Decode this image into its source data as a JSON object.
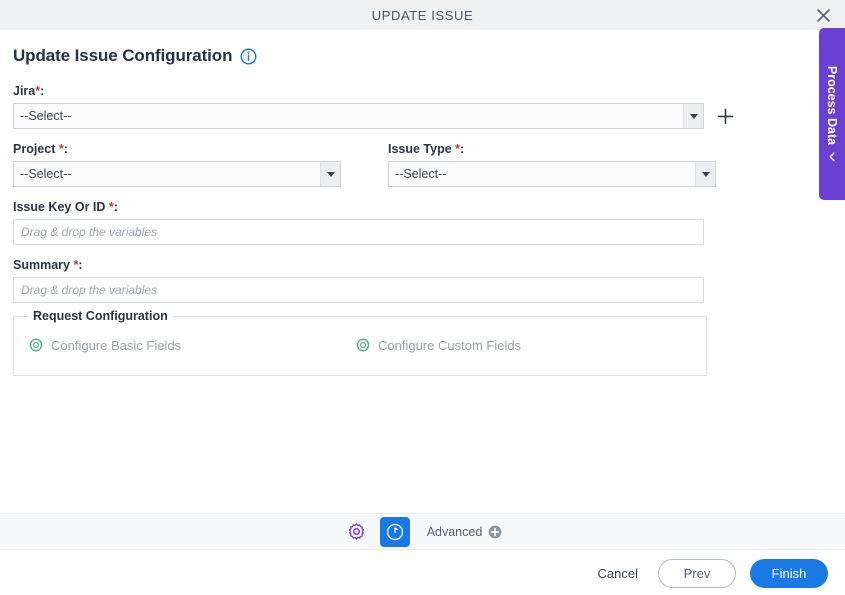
{
  "window": {
    "title": "UPDATE ISSUE",
    "close_icon": "close-icon"
  },
  "page": {
    "heading": "Update Issue Configuration",
    "info_icon": "info-icon"
  },
  "form": {
    "jira": {
      "label": "Jira",
      "required_marker": "*",
      "colon": ":",
      "value": "--Select--",
      "add_icon": "plus-icon"
    },
    "project": {
      "label": "Project",
      "required_marker": "*",
      "colon": ":",
      "value": "--Select--"
    },
    "issue_type": {
      "label": "Issue Type",
      "required_marker": "*",
      "colon": ":",
      "value": "--Select--"
    },
    "issue_key_or_id": {
      "label": "Issue Key Or ID",
      "required_marker": "*",
      "colon": ":",
      "value": "",
      "placeholder": "Drag & drop the variables"
    },
    "summary": {
      "label": "Summary",
      "required_marker": "*",
      "colon": ":",
      "value": "",
      "placeholder": "Drag & drop the variables"
    }
  },
  "request_configuration": {
    "legend": "Request Configuration",
    "items": [
      {
        "label": "Configure Basic Fields",
        "icon": "gear-icon"
      },
      {
        "label": "Configure Custom Fields",
        "icon": "gear-icon"
      }
    ]
  },
  "side_tab": {
    "label": "Process Data",
    "chevron_icon": "chevron-left-icon"
  },
  "toolbar": {
    "settings_icon": "gear-icon",
    "reload_icon": "refresh-icon",
    "advanced_label": "Advanced",
    "advanced_add_icon": "plus-circle-icon"
  },
  "footer": {
    "cancel_label": "Cancel",
    "prev_label": "Prev",
    "finish_label": "Finish"
  },
  "colors": {
    "accent_blue": "#1a79e5",
    "process_data_purple": "#6b3fd4",
    "gear_green": "#4caf7d",
    "gear_purple": "#7b3fe4",
    "required_red": "#c0392b"
  }
}
